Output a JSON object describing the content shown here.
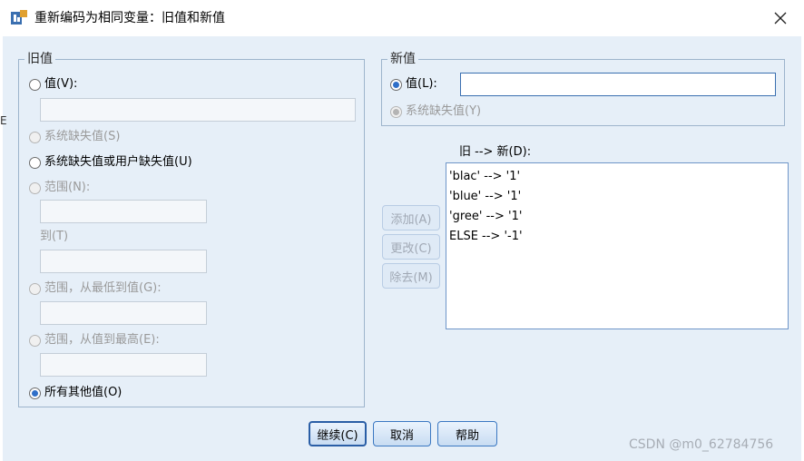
{
  "window": {
    "title": "重新编码为相同变量：旧值和新值"
  },
  "old_value": {
    "legend": "旧值",
    "value_label": "值(V):",
    "system_missing_label": "系统缺失值(S)",
    "system_or_user_missing_label": "系统缺失值或用户缺失值(U)",
    "range_label": "范围(N):",
    "to_label": "到(T)",
    "range_lowest_label": "范围，从最低到值(G):",
    "range_highest_label": "范围，从值到最高(E):",
    "all_other_label": "所有其他值(O)",
    "selected": "所有其他值(O)"
  },
  "new_value": {
    "legend": "新值",
    "value_label": "值(L):",
    "value_input": "",
    "system_missing_label": "系统缺失值(Y)",
    "selected": "值(L):"
  },
  "mapping": {
    "header": "旧 --> 新(D):",
    "items": [
      "'blac' --> '1'",
      "'blue' --> '1'",
      "'gree' --> '1'",
      "ELSE --> '-1'"
    ]
  },
  "side_buttons": {
    "add": "添加(A)",
    "change": "更改(C)",
    "remove": "除去(M)"
  },
  "footer_buttons": {
    "continue": "继续(C)",
    "cancel": "取消",
    "help": "帮助"
  },
  "watermark": "CSDN @m0_62784756",
  "edge_text": "E",
  "colors": {
    "accent": "#2f6fc8",
    "panel_bg": "#e6eff8",
    "group_border": "#9db4cc"
  },
  "icons": {
    "app": "spss-dialog-icon",
    "close": "close-icon"
  }
}
